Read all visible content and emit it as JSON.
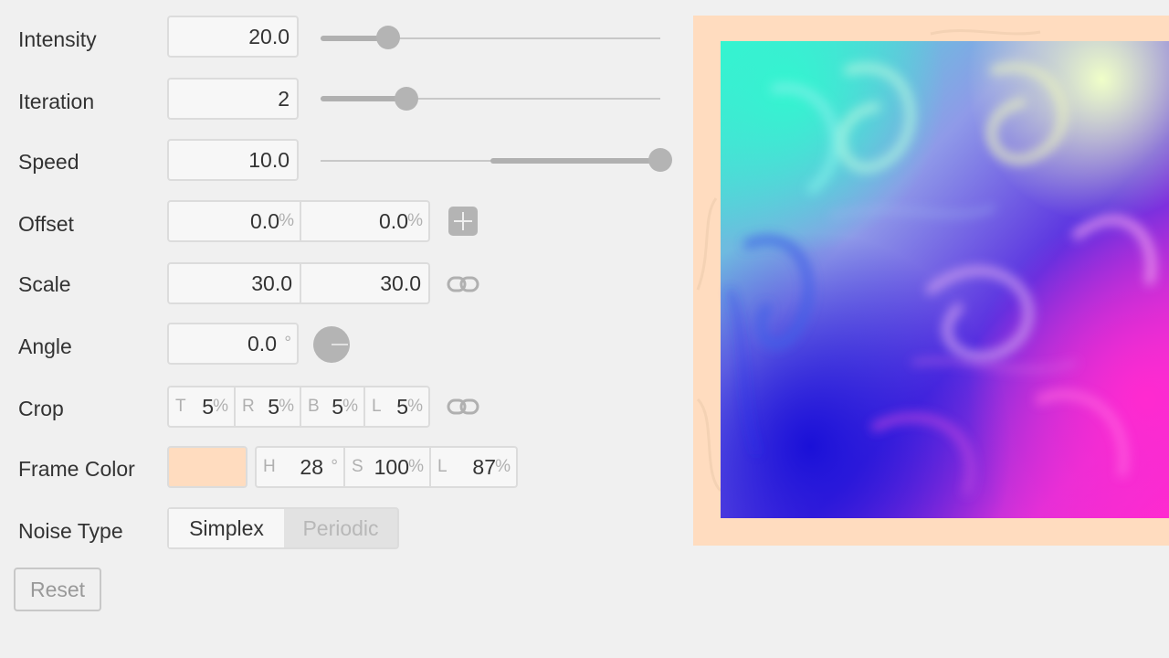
{
  "controls": {
    "intensity": {
      "label": "Intensity",
      "value": "20.0",
      "slider": 0.2
    },
    "iteration": {
      "label": "Iteration",
      "value": "2",
      "slider": 0.25
    },
    "speed": {
      "label": "Speed",
      "value": "10.0",
      "slider": 1.0
    },
    "offset": {
      "label": "Offset",
      "x": "0.0",
      "y": "0.0",
      "unit": "%",
      "add_icon": "plus-icon"
    },
    "scale": {
      "label": "Scale",
      "x": "30.0",
      "y": "30.0",
      "link_icon": "link-icon"
    },
    "angle": {
      "label": "Angle",
      "value": "0.0",
      "unit": "°",
      "dial_icon": "angle-dial-icon"
    },
    "crop": {
      "label": "Crop",
      "fields": [
        {
          "prefix": "T",
          "value": "5",
          "unit": "%"
        },
        {
          "prefix": "R",
          "value": "5",
          "unit": "%"
        },
        {
          "prefix": "B",
          "value": "5",
          "unit": "%"
        },
        {
          "prefix": "L",
          "value": "5",
          "unit": "%"
        }
      ],
      "link_icon": "link-icon"
    },
    "frame_color": {
      "label": "Frame Color",
      "swatch": "#ffdcbf",
      "fields": [
        {
          "prefix": "H",
          "value": "28",
          "unit": "°"
        },
        {
          "prefix": "S",
          "value": "100",
          "unit": "%"
        },
        {
          "prefix": "L",
          "value": "87",
          "unit": "%"
        }
      ]
    },
    "noise_type": {
      "label": "Noise Type",
      "options": [
        "Simplex",
        "Periodic"
      ],
      "selected": "Simplex"
    }
  },
  "reset_label": "Reset",
  "colors": {
    "frame": "#ffdcbf",
    "accent_cyan": "#33f5d0",
    "accent_magenta": "#ff2ad0",
    "accent_blue": "#1a10d8"
  }
}
